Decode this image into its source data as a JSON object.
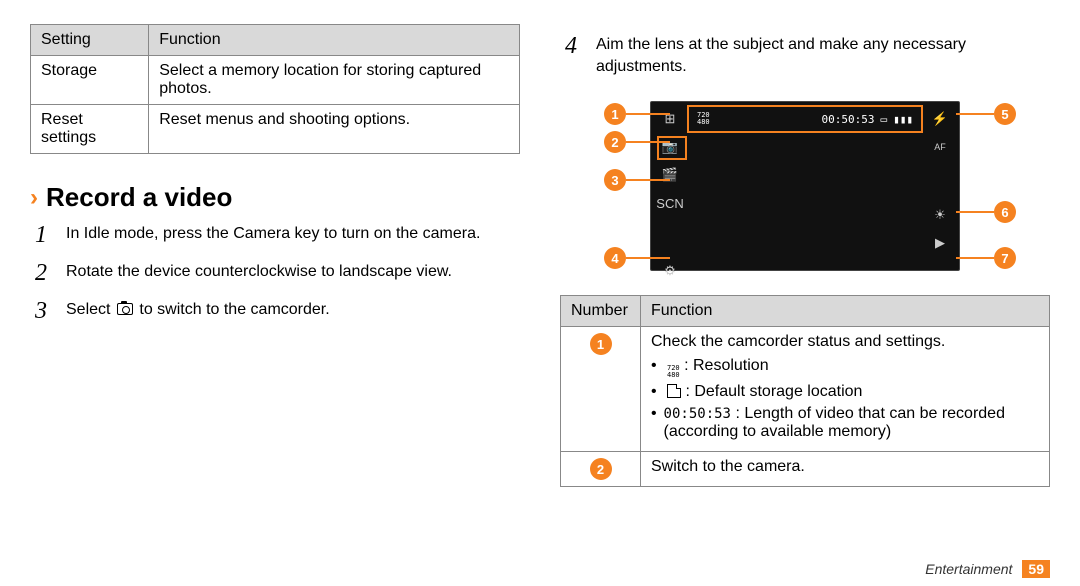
{
  "left_table": {
    "head": {
      "c1": "Setting",
      "c2": "Function"
    },
    "rows": [
      {
        "c1": "Storage",
        "c2": "Select a memory location for storing captured photos."
      },
      {
        "c1": "Reset settings",
        "c2": "Reset menus and shooting options."
      }
    ]
  },
  "section": {
    "title": "Record a video"
  },
  "steps": {
    "s1": "In Idle mode, press the Camera key to turn on the camera.",
    "s2": "Rotate the device counterclockwise to landscape view.",
    "s3a": "Select ",
    "s3b": " to switch to the camcorder.",
    "s4": "Aim the lens at the subject and make any necessary adjustments."
  },
  "viewfinder": {
    "resolution_top": "720",
    "resolution_bot": "480",
    "length": "00:50:53"
  },
  "callouts": {
    "n1": "1",
    "n2": "2",
    "n3": "3",
    "n4": "4",
    "n5": "5",
    "n6": "6",
    "n7": "7"
  },
  "right_table": {
    "head": {
      "c1": "Number",
      "c2": "Function"
    },
    "row1": {
      "num": "1",
      "intro": "Check the camcorder status and settings.",
      "bul1": ": Resolution",
      "bul2": ": Default storage location",
      "bul3_pre": "",
      "bul3_code": "00:50:53",
      "bul3_post": ": Length of video that can be recorded (according to available memory)"
    },
    "row2": {
      "num": "2",
      "fn": "Switch to the camera."
    }
  },
  "footer": {
    "section": "Entertainment",
    "page": "59"
  }
}
